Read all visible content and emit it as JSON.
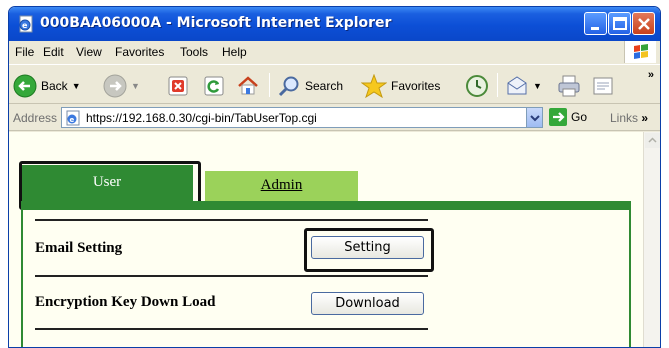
{
  "window": {
    "title": "000BAA06000A - Microsoft Internet Explorer"
  },
  "menu": {
    "items": [
      {
        "label": "File"
      },
      {
        "label": "Edit"
      },
      {
        "label": "View"
      },
      {
        "label": "Favorites"
      },
      {
        "label": "Tools"
      },
      {
        "label": "Help"
      }
    ]
  },
  "toolbar": {
    "back_label": "Back",
    "search_label": "Search",
    "favorites_label": "Favorites",
    "overflow": "»"
  },
  "addressbar": {
    "label": "Address",
    "url": "https://192.168.0.30/cgi-bin/TabUserTop.cgi",
    "go_label": "Go",
    "links_label": "Links",
    "links_overflow": "»"
  },
  "page": {
    "tabs": [
      {
        "label": "User",
        "active": true
      },
      {
        "label": "Admin",
        "active": false
      }
    ],
    "rows": [
      {
        "label": "Email Setting",
        "button": "Setting"
      },
      {
        "label": "Encryption Key Down Load",
        "button": "Download"
      }
    ]
  },
  "colors": {
    "title_bar": "#0c4fd6",
    "active_tab": "#2f8a33",
    "inactive_tab": "#9bd25a",
    "page_background": "#fffff2"
  }
}
